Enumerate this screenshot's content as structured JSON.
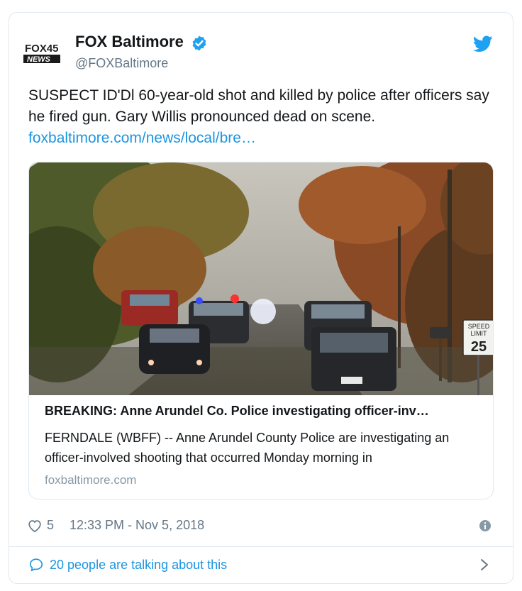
{
  "account": {
    "logo_top": "FOX45",
    "logo_bottom": "NEWS",
    "display_name": "FOX Baltimore",
    "handle": "@FOXBaltimore"
  },
  "tweet": {
    "text": "SUSPECT ID'Dl 60-year-old shot and killed by police after officers say he fired gun. Gary Willis pronounced dead on scene.",
    "link": "foxbaltimore.com/news/local/bre…"
  },
  "link_card": {
    "title": "BREAKING: Anne Arundel Co. Police investigating officer-inv…",
    "description": "FERNDALE (WBFF) -- Anne Arundel County Police are investigating an officer-involved shooting that occurred Monday morning in",
    "domain": "foxbaltimore.com",
    "sign_top": "SPEED",
    "sign_mid": "LIMIT",
    "sign_value": "25"
  },
  "footer": {
    "likes": "5",
    "timestamp": "12:33 PM - Nov 5, 2018",
    "talking": "20 people are talking about this"
  },
  "colors": {
    "link": "#1b95e0",
    "verified": "#1da1f2",
    "secondary_text": "#657786"
  },
  "icons": [
    "fox45-logo",
    "verified-icon",
    "twitter-bird-icon",
    "heart-icon",
    "info-icon",
    "speech-bubble-icon",
    "chevron-right-icon"
  ]
}
